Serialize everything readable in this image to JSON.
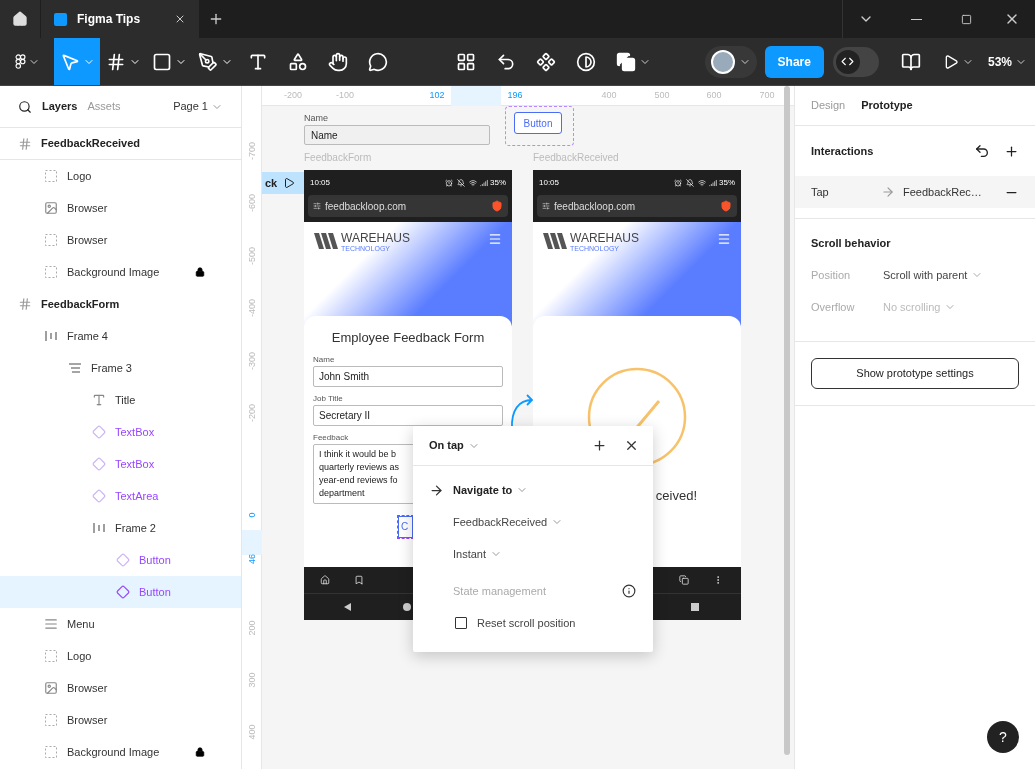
{
  "window_tabs": [
    {
      "label": "Figma Tips",
      "selected": true
    }
  ],
  "toolbar": {
    "tools": [
      {
        "kind": "move",
        "selected": true
      },
      {
        "kind": "frame",
        "selected": false
      },
      {
        "kind": "shape",
        "selected": false
      },
      {
        "kind": "pen",
        "selected": false
      },
      {
        "kind": "text",
        "selected": false
      },
      {
        "kind": "resources",
        "selected": false
      },
      {
        "kind": "hand",
        "selected": false
      },
      {
        "kind": "comment",
        "selected": false
      }
    ],
    "share": "Share",
    "dev_mode_on": false,
    "zoom": "53%"
  },
  "left_panel": {
    "tabs": [
      {
        "label": "Layers",
        "selected": true
      },
      {
        "label": "Assets",
        "selected": false
      }
    ],
    "page": "Page 1",
    "layers": [
      {
        "name": "FeedbackReceived",
        "kind": "frame",
        "locked": false,
        "selected": false,
        "children": [
          {
            "name": "Logo",
            "kind": "group",
            "locked": false,
            "selected": false
          },
          {
            "name": "Browser",
            "kind": "image",
            "locked": false,
            "selected": false
          },
          {
            "name": "Browser",
            "kind": "group",
            "locked": false,
            "selected": false
          },
          {
            "name": "Background Image",
            "kind": "group",
            "locked": true,
            "selected": false
          }
        ]
      },
      {
        "name": "FeedbackForm",
        "kind": "frame",
        "locked": false,
        "selected": false,
        "children": [
          {
            "name": "Frame 4",
            "kind": "row",
            "locked": false,
            "selected": false,
            "children": [
              {
                "name": "Frame 3",
                "kind": "column",
                "locked": false,
                "selected": false,
                "children": [
                  {
                    "name": "Title",
                    "kind": "text",
                    "locked": false,
                    "selected": false
                  },
                  {
                    "name": "TextBox",
                    "kind": "instance",
                    "locked": false,
                    "selected": false
                  },
                  {
                    "name": "TextBox",
                    "kind": "instance",
                    "locked": false,
                    "selected": false
                  },
                  {
                    "name": "TextArea",
                    "kind": "instance",
                    "locked": false,
                    "selected": false
                  },
                  {
                    "name": "Frame 2",
                    "kind": "row",
                    "locked": false,
                    "selected": false,
                    "children": [
                      {
                        "name": "Button",
                        "kind": "instance",
                        "locked": false,
                        "selected": false
                      },
                      {
                        "name": "Button",
                        "kind": "instance",
                        "locked": false,
                        "selected": true
                      }
                    ]
                  }
                ]
              }
            ]
          },
          {
            "name": "Menu",
            "kind": "menu",
            "locked": false,
            "selected": false
          },
          {
            "name": "Logo",
            "kind": "group",
            "locked": false,
            "selected": false
          },
          {
            "name": "Browser",
            "kind": "image",
            "locked": false,
            "selected": false
          },
          {
            "name": "Browser",
            "kind": "group",
            "locked": false,
            "selected": false
          },
          {
            "name": "Background Image",
            "kind": "group",
            "locked": true,
            "selected": false
          }
        ]
      }
    ]
  },
  "canvas": {
    "ruler_top": [
      {
        "label": "-200",
        "highlighted": false
      },
      {
        "label": "-100",
        "highlighted": false
      },
      {
        "label": "102",
        "highlighted": true
      },
      {
        "label": "196",
        "highlighted": true
      },
      {
        "label": "400",
        "highlighted": false
      },
      {
        "label": "500",
        "highlighted": false
      },
      {
        "label": "600",
        "highlighted": false
      },
      {
        "label": "700",
        "highlighted": false
      }
    ],
    "ruler_left": [
      {
        "label": "-700",
        "highlighted": false
      },
      {
        "label": "-600",
        "highlighted": false
      },
      {
        "label": "-500",
        "highlighted": false
      },
      {
        "label": "-400",
        "highlighted": false
      },
      {
        "label": "-300",
        "highlighted": false
      },
      {
        "label": "-200",
        "highlighted": false
      },
      {
        "label": "0",
        "highlighted": true
      },
      {
        "label": "46",
        "highlighted": true
      },
      {
        "label": "200",
        "highlighted": false
      },
      {
        "label": "300",
        "highlighted": false
      },
      {
        "label": "400",
        "highlighted": false
      }
    ],
    "flow_label": "ck",
    "components": {
      "input_label": "Name",
      "input_value": "Name",
      "button_label": "Button"
    },
    "frames": [
      {
        "title": "FeedbackForm",
        "kind": "form",
        "time": "10:05",
        "battery": "35%",
        "url": "feedbackloop.com",
        "brand": "WAREHAUS",
        "brand_sub": "TECHNOLOGY",
        "heading": "Employee Feedback Form",
        "fields": [
          {
            "label": "Name",
            "value": "John Smith"
          },
          {
            "label": "Job Title",
            "value": "Secretary II"
          }
        ],
        "textarea": {
          "label": "Feedback",
          "lines": [
            "I think it would be b",
            "quarterly reviews as",
            "year-end reviews fo",
            "department"
          ]
        },
        "button": "C"
      },
      {
        "title": "FeedbackReceived",
        "kind": "confirmation",
        "time": "10:05",
        "battery": "35%",
        "url": "feedbackloop.com",
        "brand": "WAREHAUS",
        "brand_sub": "TECHNOLOGY",
        "message": "ceived!"
      }
    ]
  },
  "popup": {
    "trigger": "On tap",
    "action": "Navigate to",
    "destination": "FeedbackReceived",
    "animation": "Instant",
    "section": "State management",
    "options": [
      {
        "label": "Reset scroll position",
        "checked": false
      }
    ]
  },
  "right_panel": {
    "tabs": [
      {
        "label": "Design",
        "selected": false
      },
      {
        "label": "Prototype",
        "selected": true
      }
    ],
    "interactions": {
      "title": "Interactions",
      "items": [
        {
          "trigger": "Tap",
          "target": "FeedbackRec…"
        }
      ]
    },
    "scroll": {
      "title": "Scroll behavior",
      "settings": [
        {
          "label": "Position",
          "value": "Scroll with parent",
          "disabled": false
        },
        {
          "label": "Overflow",
          "value": "No scrolling",
          "disabled": true
        }
      ]
    },
    "settings_button": "Show prototype settings",
    "help": "?"
  }
}
